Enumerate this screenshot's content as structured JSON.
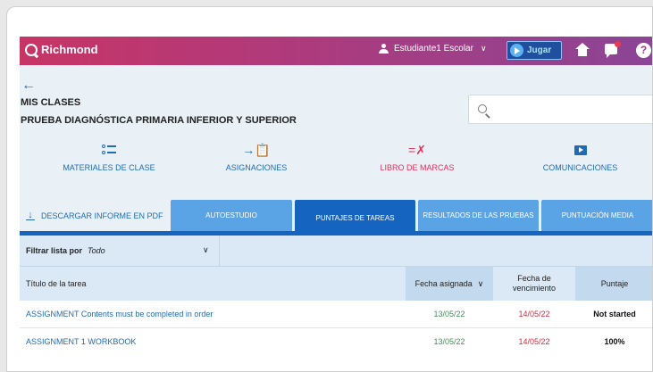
{
  "header": {
    "brand": "Richmond",
    "user_name": "Estudiante1 Escolar",
    "play_label": "Jugar",
    "help_label": "?"
  },
  "breadcrumb": {
    "back_label": "←",
    "section": "MIS CLASES",
    "class_name": "PRUEBA DIAGNÓSTICA PRIMARIA INFERIOR Y SUPERIOR"
  },
  "search": {
    "placeholder": ""
  },
  "nav": {
    "items": [
      {
        "label": "MATERIALES DE CLASE",
        "icon": "list-icon"
      },
      {
        "label": "ASIGNACIONES",
        "icon": "assignment-icon",
        "glyph": "→📋"
      },
      {
        "label": "LIBRO DE MARCAS",
        "icon": "gradebook-icon",
        "glyph": "=✗",
        "active": true
      },
      {
        "label": "COMUNICACIONES",
        "icon": "presentation-icon"
      }
    ]
  },
  "tabs": {
    "download_label": "DESCARGAR INFORME EN PDF",
    "items": [
      {
        "label": "AUTOESTUDIO"
      },
      {
        "label": "PUNTAJES DE TAREAS",
        "active": true
      },
      {
        "label": "RESULTADOS DE LAS PRUEBAS"
      },
      {
        "label": "PUNTUACIÓN MEDIA"
      }
    ]
  },
  "filter": {
    "label": "Filtrar lista por",
    "value": "Todo"
  },
  "table": {
    "columns": {
      "title": "Título de la tarea",
      "assigned": "Fecha asignada",
      "due_line1": "Fecha de",
      "due_line2": "vencimiento",
      "score": "Puntaje"
    },
    "rows": [
      {
        "title": "ASSIGNMENT Contents must be completed in order",
        "assigned": "13/05/22",
        "due": "14/05/22",
        "score": "Not started"
      },
      {
        "title": "ASSIGNMENT 1 WORKBOOK",
        "assigned": "13/05/22",
        "due": "14/05/22",
        "score": "100%"
      }
    ]
  },
  "colors": {
    "accent": "#1565c0",
    "active_nav": "#e0325b",
    "due_date": "#d42a3c",
    "assigned_date": "#4a8c5a"
  }
}
